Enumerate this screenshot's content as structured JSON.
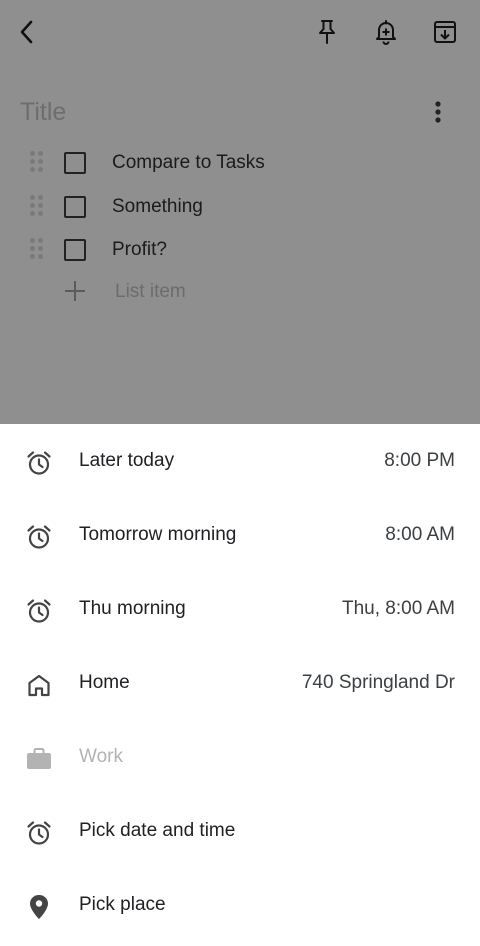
{
  "note": {
    "title_placeholder": "Title",
    "items": [
      {
        "text": "Compare to Tasks",
        "checked": false
      },
      {
        "text": "Something",
        "checked": false
      },
      {
        "text": "Profit?",
        "checked": false
      }
    ],
    "add_item_placeholder": "List item",
    "background": "#8f8f8f"
  },
  "toolbar": {
    "icons": [
      "back-arrow-icon",
      "pin-icon",
      "add-reminder-icon",
      "archive-icon",
      "more-vert-icon"
    ]
  },
  "reminder_sheet": {
    "options": [
      {
        "label": "Later today",
        "value": "8:00 PM",
        "icon": "alarm-icon"
      },
      {
        "label": "Tomorrow morning",
        "value": "8:00 AM",
        "icon": "alarm-icon"
      },
      {
        "label": "Thu morning",
        "value": "Thu, 8:00 AM",
        "icon": "alarm-icon"
      },
      {
        "label": "Home",
        "value": "740 Springland Dr",
        "icon": "home-icon"
      },
      {
        "label": "Work",
        "value": "",
        "icon": "briefcase-icon",
        "disabled": true
      },
      {
        "label": "Pick date and time",
        "value": "",
        "icon": "alarm-icon"
      },
      {
        "label": "Pick place",
        "value": "",
        "icon": "place-pin-icon"
      }
    ]
  }
}
